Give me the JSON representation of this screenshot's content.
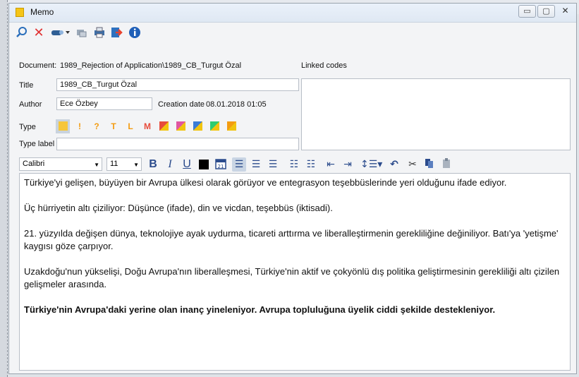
{
  "window": {
    "title": "Memo"
  },
  "toolbar": {
    "icons": [
      "search-icon",
      "delete-icon",
      "link-icon",
      "attachment-icon",
      "print-icon",
      "export-icon",
      "info-icon"
    ]
  },
  "document": {
    "label": "Document:",
    "value": "1989_Rejection of Application\\1989_CB_Turgut Özal"
  },
  "linked_codes": {
    "label": "Linked codes"
  },
  "fields": {
    "title_label": "Title",
    "title_value": "1989_CB_Turgut Özal",
    "author_label": "Author",
    "author_value": "Ece Özbey",
    "creation_label": "Creation date",
    "creation_value": "08.01.2018 01:05",
    "type_label": "Type",
    "type_label_label": "Type label",
    "type_label_value": ""
  },
  "memo_types": [
    {
      "glyph": "",
      "color": "#f6c63a",
      "selected": true
    },
    {
      "glyph": "!",
      "color": "#f39c12"
    },
    {
      "glyph": "?",
      "color": "#f39c12"
    },
    {
      "glyph": "T",
      "color": "#f39c12"
    },
    {
      "glyph": "L",
      "color": "#f39c12"
    },
    {
      "glyph": "M",
      "color": "#e74c3c"
    },
    {
      "glyph": "",
      "color": "#e74c3c",
      "color2": "#f1c40f"
    },
    {
      "glyph": "",
      "color": "#e056a0",
      "color2": "#f1c40f"
    },
    {
      "glyph": "",
      "color": "#3a7bd5",
      "color2": "#f1c40f"
    },
    {
      "glyph": "",
      "color": "#2ecc71",
      "color2": "#f1c40f"
    },
    {
      "glyph": "",
      "color": "#f39c12",
      "color2": "#f1c40f"
    }
  ],
  "format": {
    "font": "Calibri",
    "size": "11"
  },
  "content": {
    "p1": "Türkiye'yi gelişen, büyüyen bir Avrupa ülkesi olarak görüyor ve entegrasyon teşebbüslerinde yeri olduğunu ifade ediyor.",
    "p2": "Üç hürriyetin altı çiziliyor: Düşünce (ifade), din ve vicdan, teşebbüs (iktisadi).",
    "p3": "21. yüzyılda değişen dünya, teknolojiye ayak uydurma, ticareti arttırma ve liberalleştirmenin gerekliliğine değiniliyor. Batı'ya 'yetişme' kaygısı göze çarpıyor.",
    "p4": "Uzakdoğu'nun yükselişi, Doğu Avrupa'nın liberalleşmesi, Türkiye'nin aktif ve çokyönlü dış politika geliştirmesinin gerekliliği altı çizilen gelişmeler arasında.",
    "p5": "Türkiye'nin Avrupa'daki yerine olan inanç yineleniyor. Avrupa topluluğuna üyelik ciddi şekilde destekleniyor."
  }
}
